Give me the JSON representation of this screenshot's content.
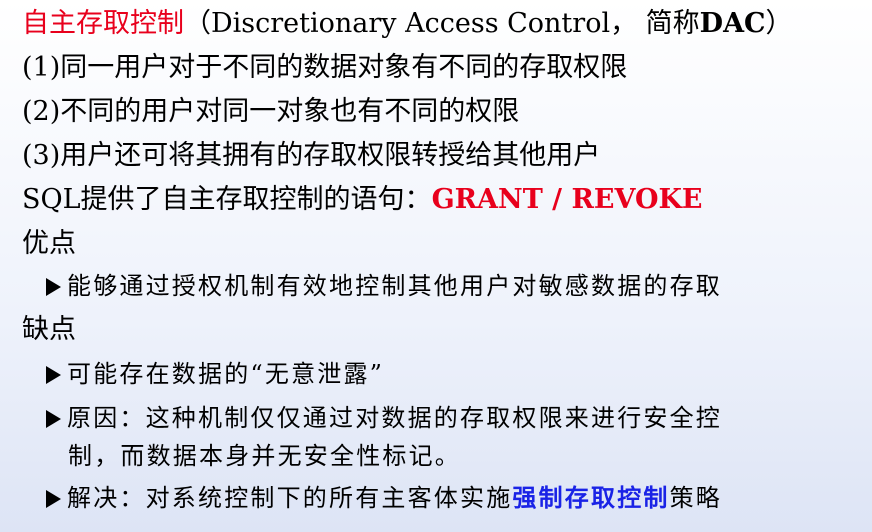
{
  "title": {
    "term": "自主存取控制",
    "paren_open": "（Discretionary Access Control， 简称",
    "abbr": "DAC",
    "paren_close": "）"
  },
  "points": [
    "(1)同一用户对于不同的数据对象有不同的存取权限",
    "(2)不同的用户对同一对象也有不同的权限",
    "(3)用户还可将其拥有的存取权限转授给其他用户"
  ],
  "sql_line": {
    "prefix": "SQL提供了自主存取控制的语句：",
    "grant": "GRANT",
    "slash": " / ",
    "revoke": "REVOKE"
  },
  "advantages": {
    "heading": "优点",
    "items": [
      "能够通过授权机制有效地控制其他用户对敏感数据的存取"
    ]
  },
  "disadvantages": {
    "heading": "缺点",
    "item1": "可能存在数据的“无意泄露”",
    "item2_line1": "原因：这种机制仅仅通过对数据的存取权限来进行安全控",
    "item2_line2": "制，而数据本身并无安全性标记。",
    "item3_prefix": "解决：对系统控制下的所有主客体实施",
    "item3_highlight": "强制存取控制",
    "item3_suffix": "策略"
  }
}
